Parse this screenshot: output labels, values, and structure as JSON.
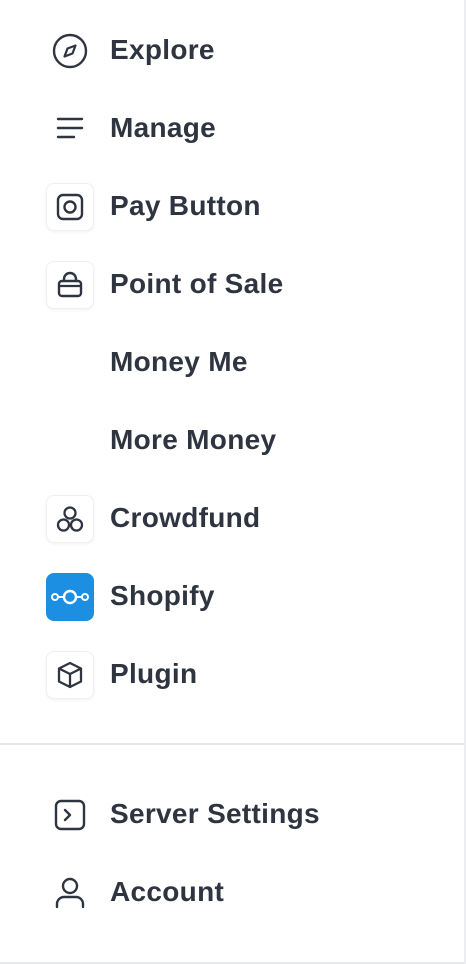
{
  "nav": {
    "explore": {
      "label": "Explore",
      "icon": "compass-icon"
    },
    "manage": {
      "label": "Manage",
      "icon": "menu-lines-icon"
    },
    "pay_button": {
      "label": "Pay Button",
      "icon": "pay-button-icon"
    },
    "point_of_sale": {
      "label": "Point of Sale",
      "icon": "shopping-bag-icon"
    },
    "money_me": {
      "label": "Money Me"
    },
    "more_money": {
      "label": "More Money"
    },
    "crowdfund": {
      "label": "Crowdfund",
      "icon": "crowdfund-icon"
    },
    "shopify": {
      "label": "Shopify",
      "icon": "shopify-icon",
      "accent": "#1d8fe2"
    },
    "plugin": {
      "label": "Plugin",
      "icon": "cube-icon"
    }
  },
  "footer_nav": {
    "server_settings": {
      "label": "Server Settings",
      "icon": "terminal-icon"
    },
    "account": {
      "label": "Account",
      "icon": "user-icon"
    }
  }
}
